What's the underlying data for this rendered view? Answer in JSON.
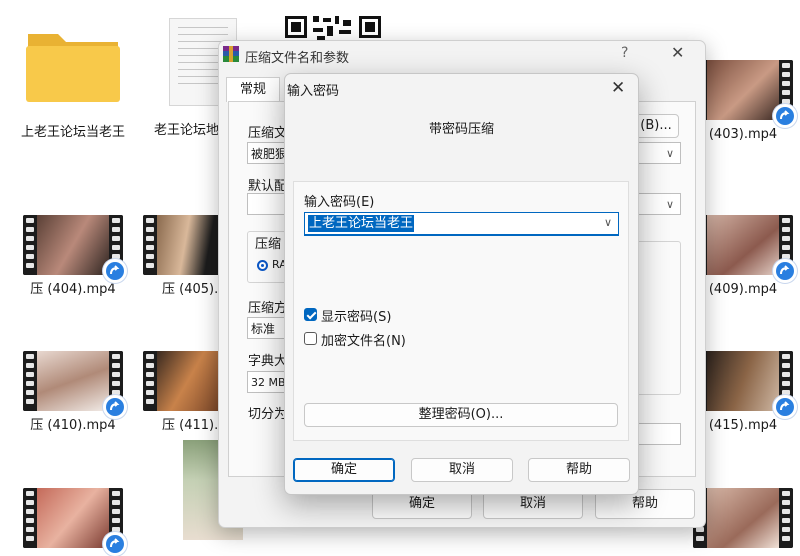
{
  "desktop": {
    "items": [
      {
        "label": "上老王论坛当老王",
        "icon": "folder-icon"
      },
      {
        "label": "老王论坛地",
        "icon": "document-icon"
      },
      {
        "label": "(403).mp4",
        "icon": "video-thumbnail"
      },
      {
        "label": "压 (404).mp4",
        "icon": "video-thumbnail"
      },
      {
        "label": "压 (405).",
        "icon": "video-thumbnail"
      },
      {
        "label": "(409).mp4",
        "icon": "video-thumbnail"
      },
      {
        "label": "压 (410).mp4",
        "icon": "video-thumbnail"
      },
      {
        "label": "压 (411).",
        "icon": "video-thumbnail"
      },
      {
        "label": "(415).mp4",
        "icon": "video-thumbnail"
      }
    ]
  },
  "archive_dialog": {
    "title": "压缩文件名和参数",
    "help": "?",
    "close": "✕",
    "tab_general": "常规",
    "archive_name_label": "压缩文",
    "archive_name_value": "被肥狠",
    "browse_button": "(B)...",
    "default_profile_label": "默认配",
    "format_group_label": "压缩",
    "format_option": "RA",
    "method_label": "压缩方",
    "method_value": "标准",
    "dict_label": "字典大",
    "dict_value": "32 MB",
    "split_label": "切分为",
    "bracket_text": ")",
    "ok_button": "确定",
    "cancel_button": "取消",
    "help_button": "帮助"
  },
  "password_dialog": {
    "title": "输入密码",
    "close": "✕",
    "subtitle": "带密码压缩",
    "password_label": "输入密码(E)",
    "password_value": "上老王论坛当老王",
    "show_password_label": "显示密码(S)",
    "show_password_checked": true,
    "encrypt_names_label": "加密文件名(N)",
    "encrypt_names_checked": false,
    "organize_button": "整理密码(O)...",
    "ok_button": "确定",
    "cancel_button": "取消",
    "help_button": "帮助"
  },
  "colors": {
    "accent": "#0067c0",
    "folder": "#f8c94a",
    "dialog_bg": "#f3f3f3"
  }
}
